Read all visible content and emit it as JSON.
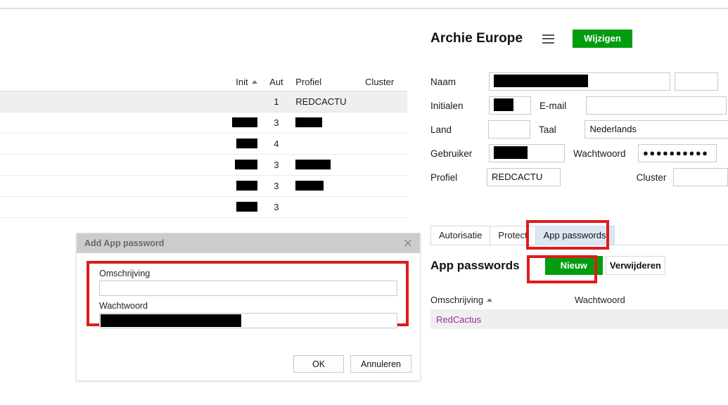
{
  "list_table": {
    "columns": [
      "",
      "Init",
      "Aut",
      "Profiel",
      "Cluster"
    ],
    "sort_column": "Init",
    "sort_direction": "asc",
    "rows": [
      {
        "name": "",
        "init": "",
        "init_redacted": 0,
        "aut": "1",
        "profiel": "REDCACTU",
        "profiel_redacted": 0,
        "cluster": "",
        "selected": true
      },
      {
        "name": "",
        "init": "",
        "init_redacted": 36,
        "aut": "3",
        "profiel": "",
        "profiel_redacted": 38,
        "cluster": "",
        "selected": false
      },
      {
        "name": "",
        "init": "",
        "init_redacted": 30,
        "aut": "4",
        "profiel": "",
        "profiel_redacted": 0,
        "cluster": "",
        "selected": false
      },
      {
        "name": "",
        "init": "",
        "init_redacted": 32,
        "aut": "3",
        "profiel": "",
        "profiel_redacted": 50,
        "cluster": "",
        "selected": false
      },
      {
        "name": "",
        "init": "",
        "init_redacted": 30,
        "aut": "3",
        "profiel": "",
        "profiel_redacted": 40,
        "cluster": "",
        "selected": false
      },
      {
        "name": "",
        "init": "",
        "init_redacted": 30,
        "aut": "3",
        "profiel": "",
        "profiel_redacted": 0,
        "cluster": "",
        "selected": false
      }
    ]
  },
  "detail": {
    "title": "Archie Europe",
    "menu_icon": "hamburger-menu-icon",
    "edit_button": "Wijzigen",
    "form": {
      "naam_label": "Naam",
      "naam_value": "",
      "naam_redacted": 134,
      "naam_extra_value": "",
      "initialen_label": "Initialen",
      "initialen_value": "",
      "initialen_redacted": 28,
      "email_label": "E-mail",
      "email_value": "",
      "land_label": "Land",
      "land_value": "",
      "taal_label": "Taal",
      "taal_value": "Nederlands",
      "gebruiker_label": "Gebruiker",
      "gebruiker_value": "",
      "gebruiker_redacted": 48,
      "wachtwoord_label": "Wachtwoord",
      "wachtwoord_value": "●●●●●●●●●●",
      "profiel_label": "Profiel",
      "profiel_value": "REDCACTU",
      "cluster_label": "Cluster",
      "cluster_value": ""
    },
    "tabs": [
      {
        "label": "Autorisatie",
        "active": false
      },
      {
        "label": "Protect",
        "active": false
      },
      {
        "label": "App passwords",
        "active": true
      }
    ],
    "app_passwords": {
      "heading": "App passwords",
      "new_button": "Nieuw",
      "delete_button": "Verwijderen",
      "columns": [
        "Omschrijving",
        "Wachtwoord"
      ],
      "sort_column": "Omschrijving",
      "sort_direction": "asc",
      "rows": [
        {
          "omschrijving": "RedCactus",
          "wachtwoord": ""
        }
      ]
    }
  },
  "modal": {
    "title": "Add App password",
    "close_icon": "close-x-icon",
    "omschrijving_label": "Omschrijving",
    "omschrijving_value": "",
    "wachtwoord_label": "Wachtwoord",
    "wachtwoord_value": "",
    "wachtwoord_redacted": 200,
    "ok_button": "OK",
    "cancel_button": "Annuleren"
  },
  "annotations": {
    "highlight_color": "#e01b1b",
    "boxes": [
      "app-passwords-tab",
      "nieuw-button",
      "modal-fields"
    ]
  },
  "colors": {
    "accent_green": "#009e0f",
    "highlight_red": "#e01b1b",
    "active_tab_blue": "#dbe8f3",
    "visited_link_purple": "#9b2d9b",
    "modal_header_gray": "#cccccc"
  }
}
